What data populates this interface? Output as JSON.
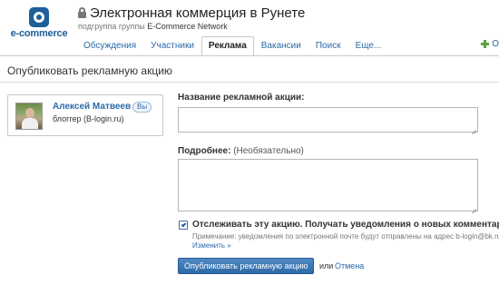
{
  "header": {
    "logo": {
      "text": "e-commerce",
      "icon": "e-commerce-logo-icon",
      "color": "#1d5f9a"
    },
    "title": "Электронная коммерция в Рунете",
    "lock_icon": "lock-icon",
    "subgroup_prefix": "подгруппа группы",
    "subgroup_network": "E-Commerce Network",
    "tabs": [
      {
        "label": "Обсуждения",
        "active": false
      },
      {
        "label": "Участники",
        "active": false
      },
      {
        "label": "Реклама",
        "active": true
      },
      {
        "label": "Вакансии",
        "active": false
      },
      {
        "label": "Поиск",
        "active": false
      },
      {
        "label": "Еще...",
        "active": false
      }
    ],
    "extra_action": {
      "icon": "plus-icon",
      "label": "O"
    }
  },
  "page": {
    "title": "Опубликовать рекламную акцию"
  },
  "user_card": {
    "name": "Алексей Матвеев",
    "badge": "Вы",
    "role": "блоггер (B-login.ru)"
  },
  "form": {
    "name_label": "Название рекламной акции:",
    "name_value": "",
    "details_label": "Подробнее:",
    "details_optional": "(Необязательно)",
    "details_value": "",
    "track_checked": true,
    "track_label": "Отслеживать эту акцию. Получать уведомления о новых комментариях.",
    "note": "Примечание: уведомления по электронной почте будут отправлены на адрес b-login@bk.ru",
    "change_link": "Изменить »",
    "submit_label": "Опубликовать рекламную акцию",
    "or_text": "или",
    "cancel_label": "Отмена"
  },
  "colors": {
    "link": "#2a6aa8",
    "button": "#2f6aa6",
    "accent_green": "#5aa33b"
  }
}
